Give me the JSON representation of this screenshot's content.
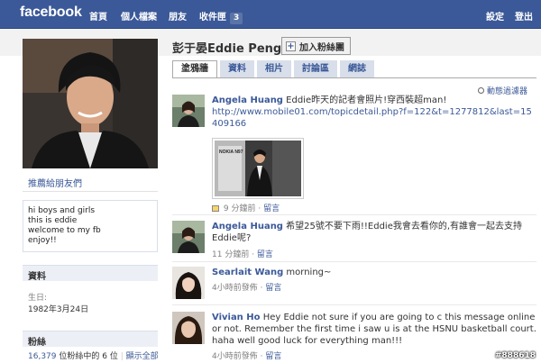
{
  "topbar": {
    "logo": "facebook",
    "nav": [
      "首頁",
      "個人檔案",
      "朋友",
      "收件匣"
    ],
    "inbox_count": "3",
    "right": [
      "設定",
      "登出"
    ]
  },
  "sidebar": {
    "recommend_link": "推薦給朋友們",
    "bio_lines": [
      "hi boys and girls",
      "this is eddie",
      "welcome to my fb",
      "enjoy!!"
    ],
    "info_header": "資料",
    "birthday_label": "生日:",
    "birthday_value": "1982年3月24日",
    "fans_header": "粉絲",
    "fans_count": "16,379",
    "fans_text": "位粉絲中的 6 位",
    "show_all": "顯示全部"
  },
  "profile": {
    "name": "彭于晏Eddie Peng",
    "add_fan_label": "加入粉絲團",
    "tabs": [
      "塗鴉牆",
      "資料",
      "相片",
      "討論區",
      "網誌"
    ],
    "filter_label": "動態過濾器"
  },
  "posts": [
    {
      "author": "Angela Huang",
      "text": "Eddie昨天的記者會照片!穿西裝超man!",
      "link": "http://www.mobile01.com/topicdetail.php?f=122&t=1277812&last=15409166",
      "thumb_caption": "NOKIA N97",
      "time": "9 分鐘前",
      "action": "留言"
    },
    {
      "author": "Angela Huang",
      "text": "希望25號不要下雨!!Eddie我會去看你的,有誰會一起去支持Eddie呢?",
      "time": "11 分鐘前",
      "action": "留言"
    },
    {
      "author": "Searlait Wang",
      "text": "morning~",
      "time": "4小時前發佈",
      "action": "留言"
    },
    {
      "author": "Vivian Ho",
      "text": "Hey Eddie not sure if you are going to c this message online or not. Remember the first time i saw u is at the HSNU basketball court. haha well good luck for everything man!!!",
      "time": "4小時前發佈",
      "action": "留言"
    }
  ],
  "watermark": "#888618"
}
